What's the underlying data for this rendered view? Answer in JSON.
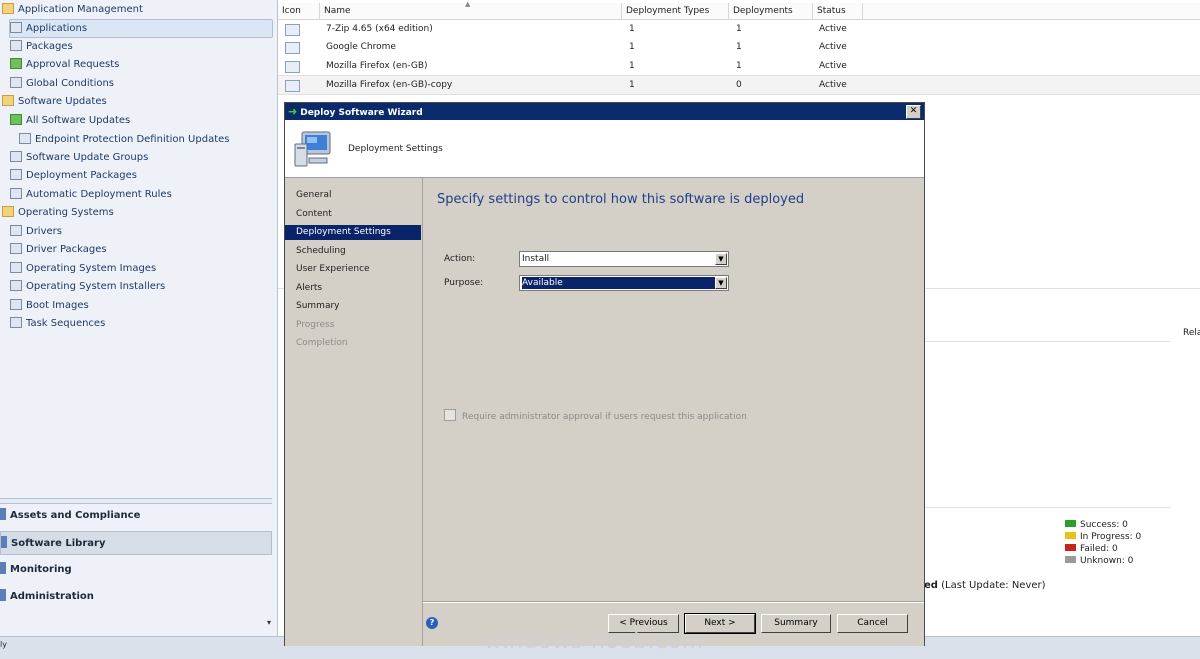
{
  "navigation": {
    "tree": [
      {
        "label": "Application Management",
        "icon": "folder-icon"
      },
      {
        "label": "Applications",
        "icon": "application-icon",
        "selected": true
      },
      {
        "label": "Packages",
        "icon": "package-icon"
      },
      {
        "label": "Approval Requests",
        "icon": "approval-icon"
      },
      {
        "label": "Global Conditions",
        "icon": "condition-icon"
      },
      {
        "label": "Software Updates",
        "icon": "folder-icon"
      },
      {
        "label": "All Software Updates",
        "icon": "updates-icon"
      },
      {
        "label": "Endpoint Protection Definition Updates",
        "icon": "updates-icon"
      },
      {
        "label": "Software Update Groups",
        "icon": "update-group-icon"
      },
      {
        "label": "Deployment Packages",
        "icon": "package-icon"
      },
      {
        "label": "Automatic Deployment Rules",
        "icon": "rule-icon"
      },
      {
        "label": "Operating Systems",
        "icon": "folder-icon"
      },
      {
        "label": "Drivers",
        "icon": "driver-icon"
      },
      {
        "label": "Driver Packages",
        "icon": "package-icon"
      },
      {
        "label": "Operating System Images",
        "icon": "os-image-icon"
      },
      {
        "label": "Operating System Installers",
        "icon": "os-installer-icon"
      },
      {
        "label": "Boot Images",
        "icon": "boot-image-icon"
      },
      {
        "label": "Task Sequences",
        "icon": "task-sequence-icon"
      }
    ],
    "workspaces": [
      {
        "label": "Assets and Compliance"
      },
      {
        "label": "Software Library",
        "selected": true
      },
      {
        "label": "Monitoring"
      },
      {
        "label": "Administration"
      }
    ],
    "more_glyph": "▾"
  },
  "list": {
    "columns": [
      "Icon",
      "Name",
      "Deployment Types",
      "Deployments",
      "Status"
    ],
    "sort_glyph": "▲",
    "rows": [
      {
        "name": "7-Zip 4.65 (x64 edition)",
        "deployment_types": "1",
        "deployments": "1",
        "status": "Active"
      },
      {
        "name": "Google Chrome",
        "deployment_types": "1",
        "deployments": "1",
        "status": "Active"
      },
      {
        "name": "Mozilla Firefox (en-GB)",
        "deployment_types": "1",
        "deployments": "1",
        "status": "Active"
      },
      {
        "name": "Mozilla Firefox (en-GB)-copy",
        "deployment_types": "1",
        "deployments": "0",
        "status": "Active"
      }
    ]
  },
  "detail": {
    "related_label": "Rela",
    "last_update_bold": "ed",
    "last_update": "(Last Update: Never)",
    "legend": [
      {
        "label": "Success: 0",
        "color": "#2aa02a"
      },
      {
        "label": "In Progress: 0",
        "color": "#e6c21a"
      },
      {
        "label": "Failed: 0",
        "color": "#c8251b"
      },
      {
        "label": "Unknown: 0",
        "color": "#9a9a9a"
      }
    ]
  },
  "status_bar": {
    "text": "ly"
  },
  "wizard": {
    "title": "Deploy Software Wizard",
    "close_glyph": "✕",
    "header_title": "Deployment Settings",
    "steps": [
      {
        "label": "General",
        "state": "normal"
      },
      {
        "label": "Content",
        "state": "normal"
      },
      {
        "label": "Deployment Settings",
        "state": "active"
      },
      {
        "label": "Scheduling",
        "state": "normal"
      },
      {
        "label": "User Experience",
        "state": "normal"
      },
      {
        "label": "Alerts",
        "state": "normal"
      },
      {
        "label": "Summary",
        "state": "normal"
      },
      {
        "label": "Progress",
        "state": "disabled"
      },
      {
        "label": "Completion",
        "state": "disabled"
      }
    ],
    "heading": "Specify settings to control how this software is deployed",
    "action_label": "Action:",
    "action_value": "Install",
    "purpose_label": "Purpose:",
    "purpose_value": "Available",
    "dropdown_glyph": "▼",
    "approval_label": "Require administrator approval if users request this application",
    "approval_checked": false,
    "help_glyph": "?",
    "buttons": {
      "previous": "< Previous",
      "next": "Next >",
      "summary": "Summary",
      "cancel": "Cancel"
    }
  },
  "watermark": "windows-noob.com"
}
